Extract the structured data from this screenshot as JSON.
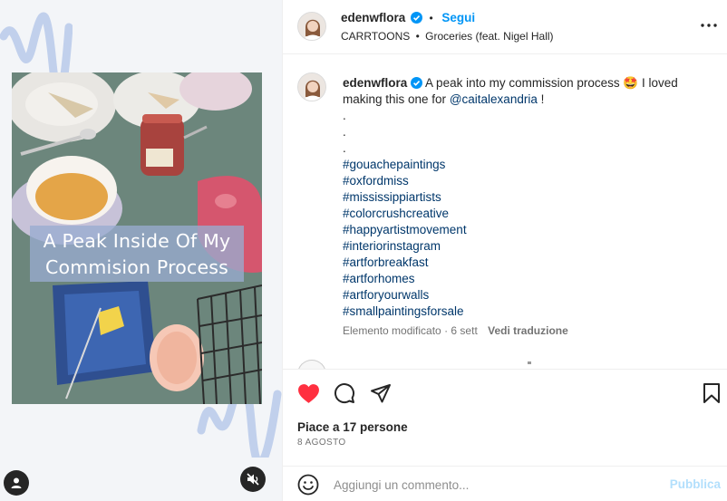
{
  "post": {
    "username": "edenwflora",
    "verified": true,
    "separator": "•",
    "follow_label": "Segui",
    "music_artist": "CARRTOONS",
    "music_separator": "•",
    "music_title": "Groceries (feat. Nigel Hall)",
    "more_label": "•••"
  },
  "media": {
    "overlay_line1": "A Peak Inside Of My",
    "overlay_line2": "Commision Process",
    "accent_color": "#9fb4dc"
  },
  "caption": {
    "username": "edenwflora",
    "text_part1": "A peak into my commission process",
    "emoji": "🤩",
    "text_part2": "I loved making this one for",
    "mention": "@caitalexandria",
    "text_part3": "!",
    "dots": [
      ".",
      ".",
      "."
    ],
    "hashtags": [
      "#gouachepaintings",
      "#oxfordmiss",
      "#mississippiartists",
      "#colorcrushcreative",
      "#happyartistmovement",
      "#interiorinstagram",
      "#artforbreakfast",
      "#artforhomes",
      "#artforyourwalls",
      "#smallpaintingsforsale"
    ],
    "edited_label": "Elemento modificato",
    "meta_separator": "·",
    "age": "6 sett",
    "translate_label": "Vedi traduzione"
  },
  "actions": {
    "liked": true,
    "like_color": "#ff3040",
    "likes_text": "Piace a 17 persone",
    "date": "8 AGOSTO"
  },
  "comment_box": {
    "placeholder": "Aggiungi un commento...",
    "publish_label": "Pubblica",
    "publish_color": "#b2dffc"
  },
  "icons": {
    "user_tag": "user-tag-icon",
    "mute": "muted-speaker-icon",
    "like": "heart-icon",
    "comment": "comment-icon",
    "share": "paper-plane-icon",
    "save": "bookmark-icon",
    "emoji": "smiley-icon",
    "more": "more-options-icon",
    "verified": "verified-badge-icon"
  }
}
